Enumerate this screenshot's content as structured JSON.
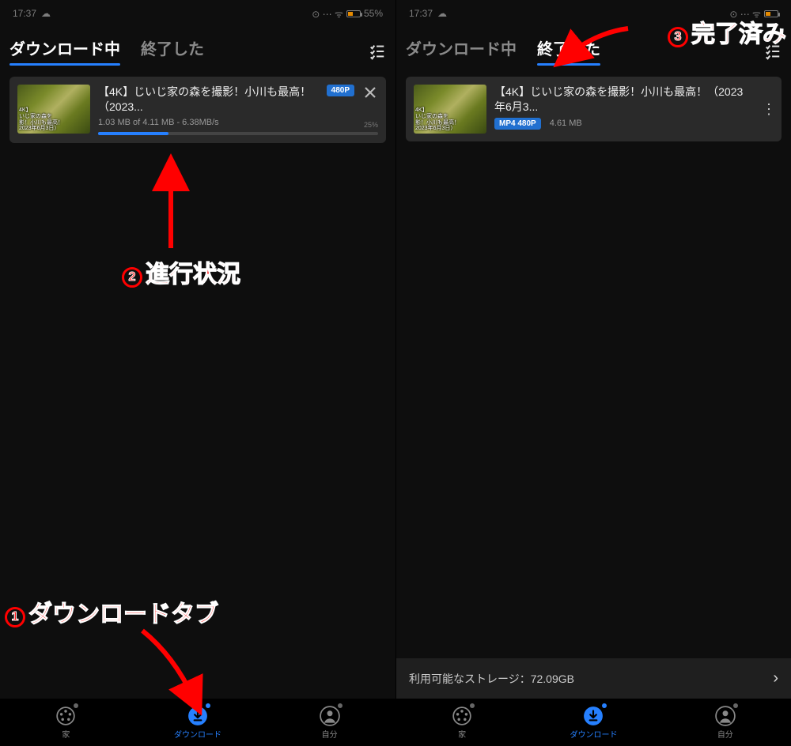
{
  "status": {
    "time": "17:37",
    "battery_pct": "55%"
  },
  "tabs": {
    "downloading": "ダウンロード中",
    "finished": "終了した"
  },
  "left": {
    "active_tab": "downloading",
    "item": {
      "title": "【4K】じいじ家の森を撮影！小川も最高！（2023...",
      "thumb_caption": "4K】\nいじ家の森を\n影！小川も最高！\n2023年6月3日）",
      "quality": "480P",
      "progress_text": "1.03 MB of 4.11 MB - 6.38MB/s",
      "progress_pct_label": "25%",
      "progress_pct": 25
    }
  },
  "right": {
    "active_tab": "finished",
    "item": {
      "title": "【4K】じいじ家の森を撮影！小川も最高！（2023年6月3...",
      "thumb_caption": "4K】\nいじ家の森を\n影！小川も最高！\n2023年6月3日）",
      "format_badge": "MP4 480P",
      "size": "4.61 MB"
    },
    "storage_label": "利用可能なストレージ：72.09GB"
  },
  "bnav": {
    "home": "家",
    "download": "ダウンロード",
    "me": "自分"
  },
  "annotations": {
    "a1": "ダウンロードタブ",
    "a2": "進行状況",
    "a3": "完了済み"
  },
  "colors": {
    "accent": "#2680ff",
    "annotation": "#ff0000"
  }
}
